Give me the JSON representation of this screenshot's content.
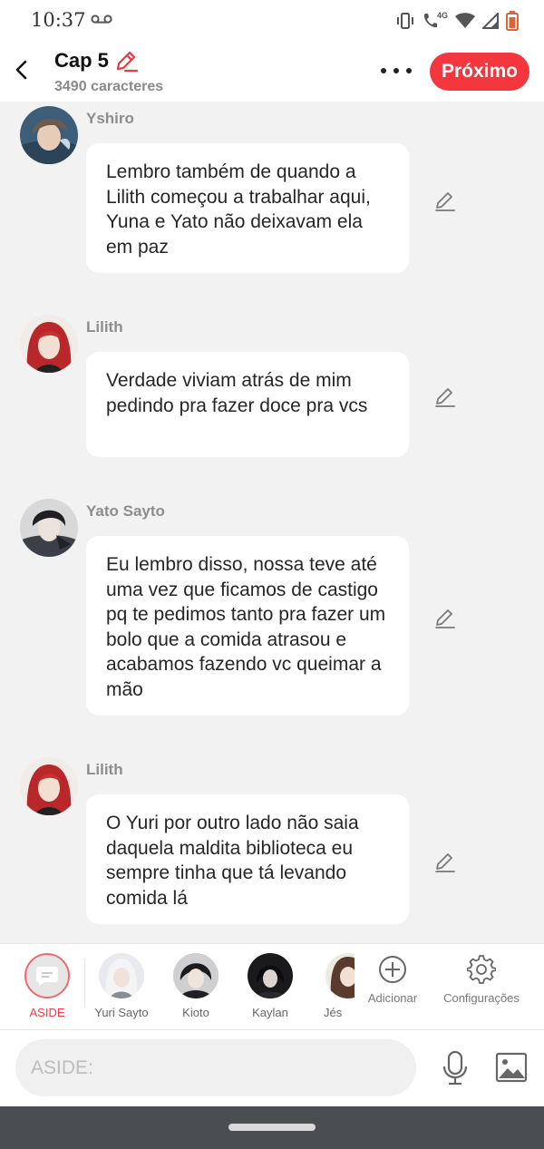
{
  "status_bar": {
    "time": "10:37",
    "network": "4G"
  },
  "header": {
    "title": "Cap 5",
    "char_count": "3490 caracteres",
    "next_label": "Próximo"
  },
  "messages": [
    {
      "speaker": "Yshiro",
      "text": "Lembro também de quando a Lilith começou a trabalhar aqui, Yuna e Yato não deixavam ela em paz"
    },
    {
      "speaker": "Lilith",
      "text": "Verdade viviam atrás de mim pedindo pra fazer doce pra vcs"
    },
    {
      "speaker": "Yato Sayto",
      "text": "Eu lembro disso, nossa teve até uma vez que ficamos de castigo pq te pedimos tanto pra fazer um bolo que a comida atrasou e acabamos fazendo vc queimar a mão"
    },
    {
      "speaker": "Lilith",
      "text": "O Yuri por outro lado não saia daquela maldita biblioteca eu sempre tinha que tá levando comida lá"
    }
  ],
  "characters": {
    "aside": "ASIDE",
    "list": [
      "Yuri Sayto",
      "Kioto",
      "Kaylan",
      "Jés"
    ],
    "add_label": "Adicionar",
    "settings_label": "Configurações"
  },
  "input": {
    "placeholder": "ASIDE:"
  },
  "colors": {
    "accent": "#f4373f",
    "background": "#f2f2f2",
    "bubble": "#ffffff",
    "name_gray": "#8d8d8d",
    "nav_bar": "#4a4d52"
  },
  "icons": [
    "back-arrow-icon",
    "pencil-icon",
    "more-dots-icon",
    "edit-pencil-icon",
    "chat-bubble-icon",
    "add-circle-icon",
    "gear-icon",
    "microphone-icon",
    "image-icon",
    "voicemail-icon",
    "vibrate-icon",
    "wifi-icon",
    "signal-icon",
    "battery-icon"
  ]
}
